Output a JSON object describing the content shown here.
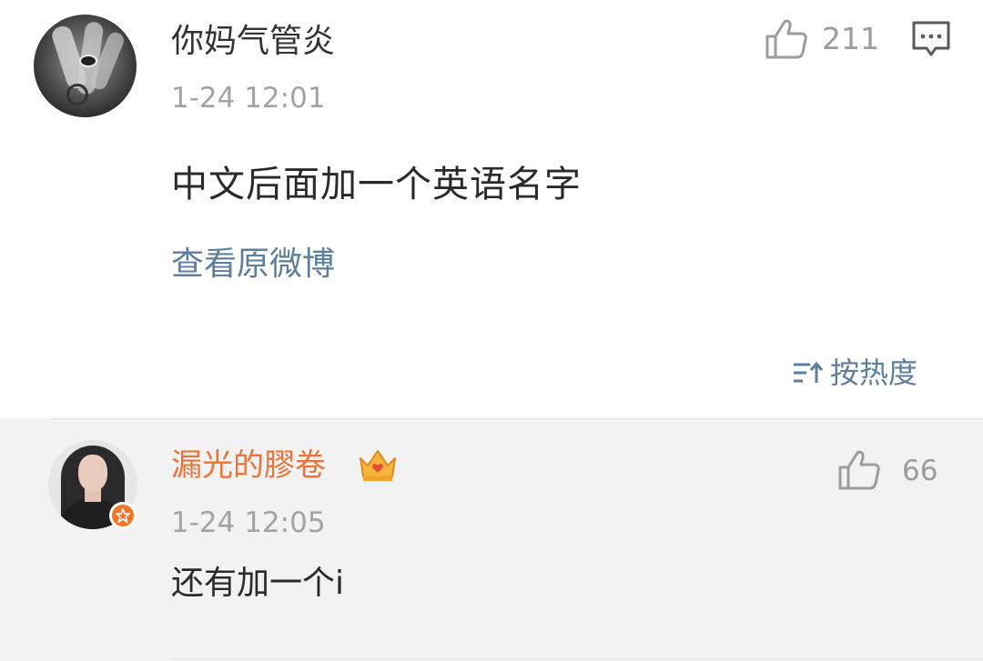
{
  "main_comment": {
    "username": "你妈气管炎",
    "timestamp": "1-24 12:01",
    "content": "中文后面加一个英语名字",
    "view_original": "查看原微博",
    "like_count": "211",
    "icons": {
      "like": "thumbs-up-icon",
      "comment": "comment-icon"
    }
  },
  "sort": {
    "label": "按热度",
    "icon": "sort-icon"
  },
  "reply": {
    "username": "漏光的膠卷",
    "timestamp": "1-24 12:05",
    "content": "还有加一个i",
    "like_count": "66",
    "icons": {
      "like": "thumbs-up-icon",
      "badge": "crown-icon",
      "verified": "verified-badge-icon"
    }
  },
  "colors": {
    "link": "#5d7e9c",
    "reply_username": "#e9743a",
    "muted": "#a3a3a3",
    "text": "#2a2a2a",
    "reply_background": "#f2f2f2"
  }
}
